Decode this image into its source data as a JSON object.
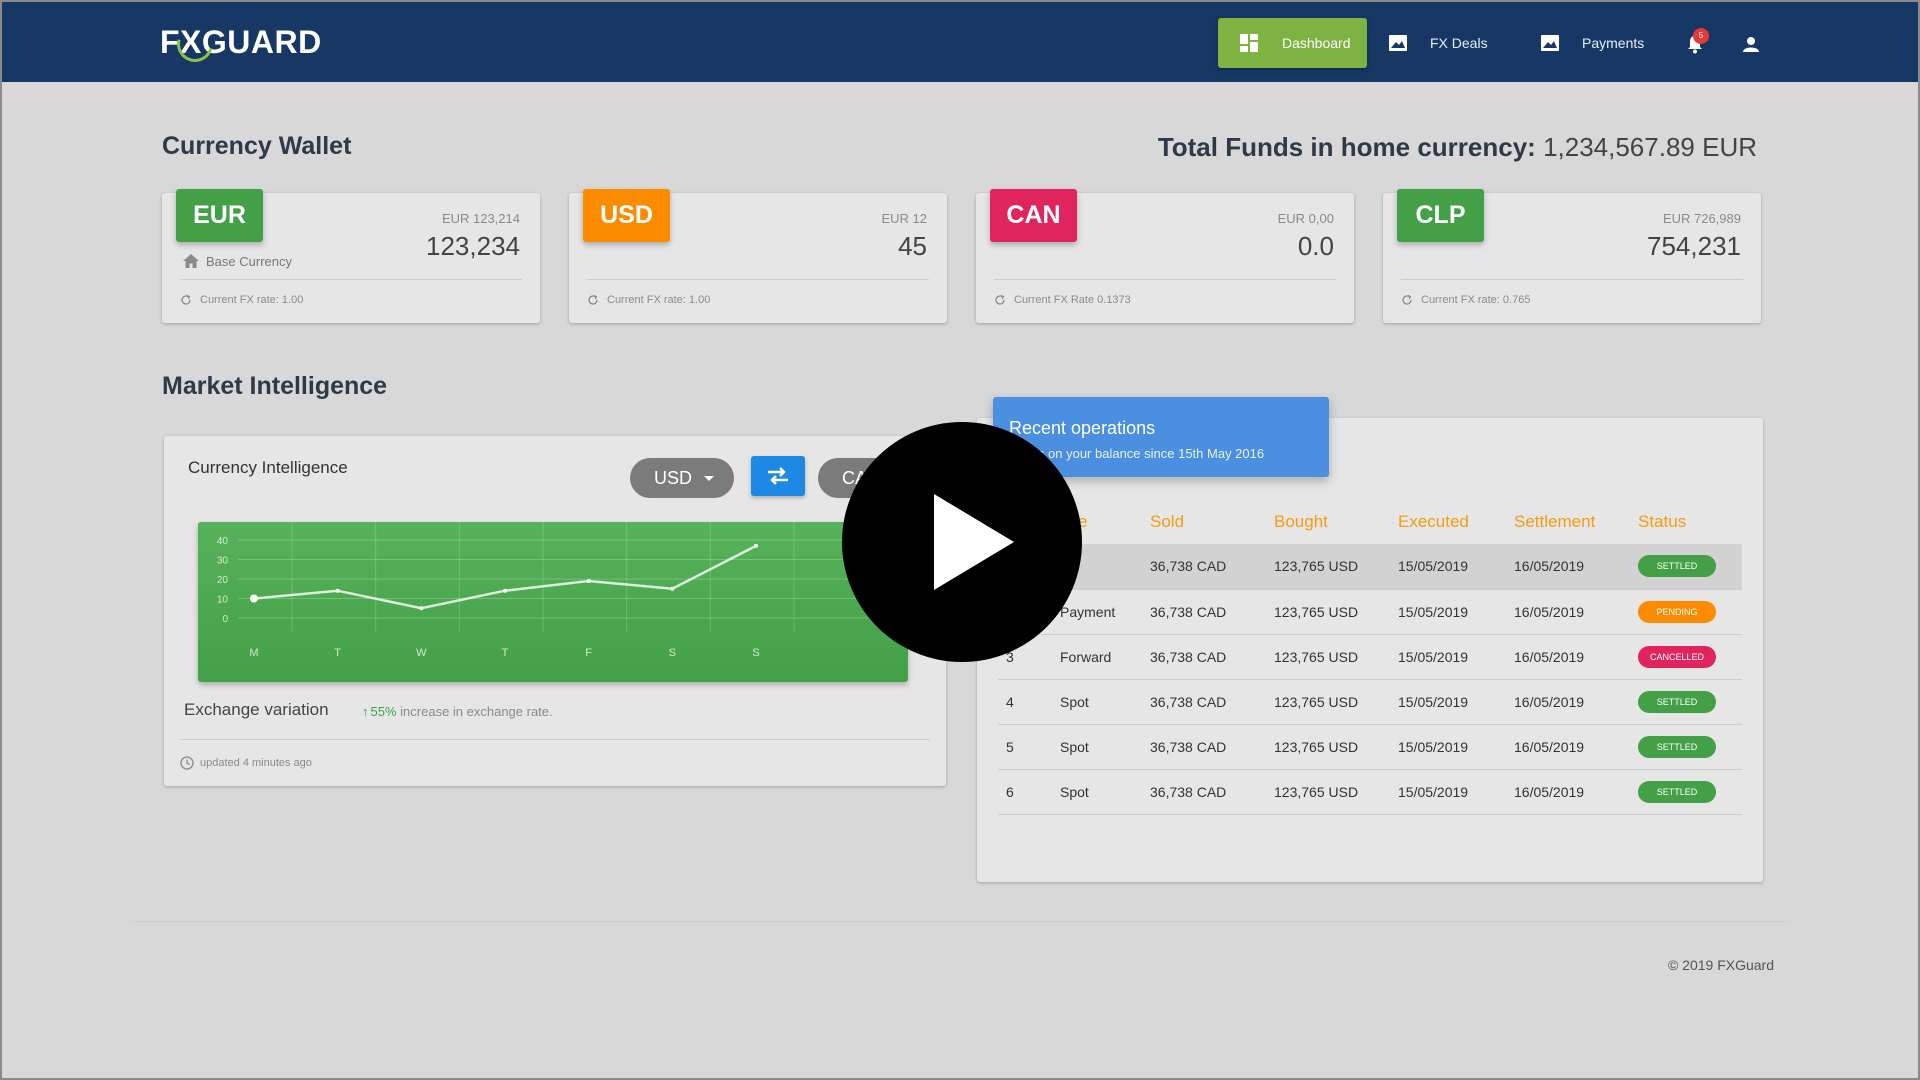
{
  "nav": {
    "logo": {
      "pre": "F",
      "x": "X",
      "post": "GUARD"
    },
    "items": [
      {
        "label": "Dashboard",
        "icon": "dashboard-icon",
        "active": true
      },
      {
        "label": "FX Deals",
        "icon": "image-icon"
      },
      {
        "label": "Payments",
        "icon": "image-icon"
      }
    ],
    "notifications_count": "5",
    "colors": {
      "bar": "#173764",
      "active": "#7cb342"
    }
  },
  "wallet": {
    "title": "Currency Wallet",
    "total_label": "Total Funds in home currency:",
    "total_value": "1,234,567.89 EUR",
    "cards": [
      {
        "code": "EUR",
        "color": "#43a047",
        "sub": "EUR 123,214",
        "value": "123,234",
        "base": "Base Currency",
        "rate": "Current FX rate: 1.00"
      },
      {
        "code": "USD",
        "color": "#fb8c00",
        "sub": "EUR 12",
        "value": "45",
        "rate": "Current FX rate: 1.00"
      },
      {
        "code": "CAN",
        "color": "#e0245e",
        "sub": "EUR 0,00",
        "value": "0.0",
        "rate": "Current FX Rate 0.1373"
      },
      {
        "code": "CLP",
        "color": "#43a047",
        "sub": "EUR 726,989",
        "value": "754,231",
        "rate": "Current FX rate: 0.765"
      }
    ]
  },
  "market": {
    "title": "Market Intelligence",
    "currency_intelligence": {
      "title": "Currency Intelligence",
      "from": "USD",
      "to": "CA",
      "exchange_label": "Exchange variation",
      "variation_pct": "55%",
      "variation_text": "increase in exchange rate.",
      "updated": "updated 4 minutes ago"
    }
  },
  "chart_data": {
    "type": "line",
    "categories": [
      "M",
      "T",
      "W",
      "T",
      "F",
      "S",
      "S"
    ],
    "series": [
      {
        "values": [
          10,
          14,
          5,
          14,
          19,
          15,
          37
        ]
      }
    ],
    "yticks": [
      "0",
      "10",
      "20",
      "30",
      "40"
    ],
    "ylim": [
      0,
      40
    ],
    "grid": true
  },
  "operations": {
    "title": "Recent operations",
    "subtitle": "ments on your balance since 15th May 2016",
    "columns": [
      "ype",
      "Sold",
      "Bought",
      "Executed",
      "Settlement",
      "Status"
    ],
    "rows": [
      {
        "id": "",
        "type": "ot",
        "sold": "36,738 CAD",
        "bought": "123,765 USD",
        "executed": "15/05/2019",
        "settlement": "16/05/2019",
        "status": "SETTLED",
        "color": "#43a047"
      },
      {
        "id": "",
        "type": "Payment",
        "sold": "36,738 CAD",
        "bought": "123,765 USD",
        "executed": "15/05/2019",
        "settlement": "16/05/2019",
        "status": "PENDING",
        "color": "#fb8c00"
      },
      {
        "id": "3",
        "type": "Forward",
        "sold": "36,738 CAD",
        "bought": "123,765 USD",
        "executed": "15/05/2019",
        "settlement": "16/05/2019",
        "status": "CANCELLED",
        "color": "#e0245e"
      },
      {
        "id": "4",
        "type": "Spot",
        "sold": "36,738 CAD",
        "bought": "123,765 USD",
        "executed": "15/05/2019",
        "settlement": "16/05/2019",
        "status": "SETTLED",
        "color": "#43a047"
      },
      {
        "id": "5",
        "type": "Spot",
        "sold": "36,738 CAD",
        "bought": "123,765 USD",
        "executed": "15/05/2019",
        "settlement": "16/05/2019",
        "status": "SETTLED",
        "color": "#43a047"
      },
      {
        "id": "6",
        "type": "Spot",
        "sold": "36,738 CAD",
        "bought": "123,765 USD",
        "executed": "15/05/2019",
        "settlement": "16/05/2019",
        "status": "SETTLED",
        "color": "#43a047"
      }
    ]
  },
  "footer": {
    "copyright": "© 2019 FXGuard"
  },
  "overlay": {
    "icon": "play-icon"
  }
}
